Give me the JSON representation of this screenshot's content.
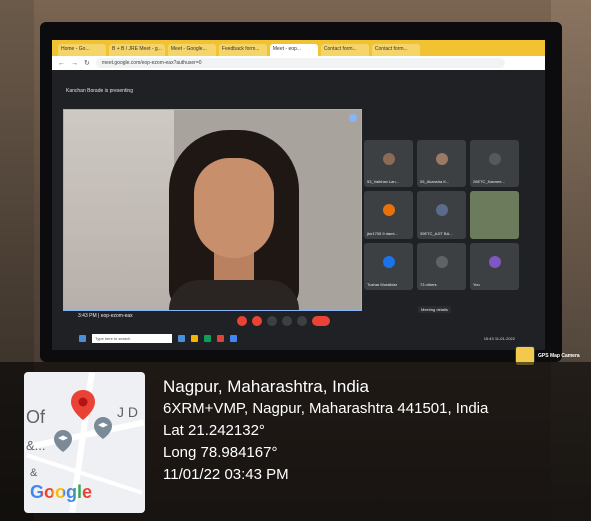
{
  "browser": {
    "tabs": [
      "Home - Go...",
      "B + B / JRE Meet - g...",
      "Meet - Google...",
      "Feedback form...",
      "Meet - eop...",
      "Contact form...",
      "Contact form..."
    ],
    "active_tab_index": 4,
    "url": "meet.google.com/eop-ezom-eax?authuser=0"
  },
  "meet": {
    "presenting_text": "Kanchan Borade is presenting",
    "time_code": "3:43 PM  |  eop-ezom-eax",
    "meeting_details_label": "Meeting details",
    "participants": [
      {
        "name": "53_Vaibhav Lan...",
        "color": "#8b6b55"
      },
      {
        "name": "05_Akansha K...",
        "color": "#9a7a64"
      },
      {
        "name": "26ETC_Navnee...",
        "color": "#3c4043"
      },
      {
        "name": "jbe1705 9 dami...",
        "color": "#e8710a"
      },
      {
        "name": "39ETC_AJIT BA...",
        "color": "#5b6b8c"
      },
      {
        "name": "",
        "color": "#5a6b4c"
      },
      {
        "name": "Tushar Muralidar",
        "color": "#1a73e8"
      },
      {
        "name": "73 others",
        "color": "#5f6368"
      },
      {
        "name": "You",
        "color": "#7e57c2"
      }
    ]
  },
  "taskbar": {
    "search_placeholder": "Type here to search",
    "clock": "15:43\n11-01-2022"
  },
  "gps": {
    "camera_label": "GPS Map Camera",
    "city": "Nagpur, Maharashtra, India",
    "address": "6XRM+VMP, Nagpur, Maharashtra 441501, India",
    "lat": "Lat 21.242132°",
    "long": "Long 78.984167°",
    "datetime": "11/01/22 03:43 PM"
  },
  "map": {
    "label_of": "Of",
    "label_jd": "J D",
    "label_amp": "&...",
    "label_amp2": "&",
    "google": "Google"
  }
}
